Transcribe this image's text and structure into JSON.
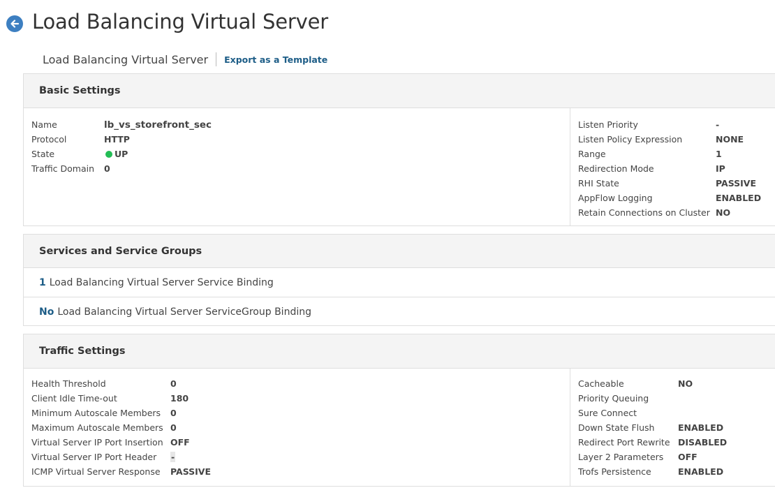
{
  "page": {
    "title": "Load Balancing Virtual Server",
    "subtitle": "Load Balancing Virtual Server",
    "export_link": "Export as a Template"
  },
  "basic_settings": {
    "header": "Basic Settings",
    "left": [
      {
        "label": "Name",
        "value": "lb_vs_storefront_sec"
      },
      {
        "label": "Protocol",
        "value": "HTTP"
      },
      {
        "label": "State",
        "value": "UP",
        "status_color": "#23bd55"
      },
      {
        "label": "Traffic Domain",
        "value": "0"
      }
    ],
    "right": [
      {
        "label": "Listen Priority",
        "value": "-"
      },
      {
        "label": "Listen Policy Expression",
        "value": "NONE"
      },
      {
        "label": "Range",
        "value": "1"
      },
      {
        "label": "Redirection Mode",
        "value": "IP"
      },
      {
        "label": "RHI State",
        "value": "PASSIVE"
      },
      {
        "label": "AppFlow Logging",
        "value": "ENABLED"
      },
      {
        "label": "Retain Connections on Cluster",
        "value": "NO"
      }
    ]
  },
  "services": {
    "header": "Services and Service Groups",
    "rows": [
      {
        "count": "1",
        "label": "Load Balancing Virtual Server Service Binding"
      },
      {
        "count": "No",
        "label": "Load Balancing Virtual Server ServiceGroup Binding"
      }
    ]
  },
  "traffic_settings": {
    "header": "Traffic Settings",
    "left": [
      {
        "label": "Health Threshold",
        "value": "0"
      },
      {
        "label": "Client Idle Time-out",
        "value": "180"
      },
      {
        "label": "Minimum Autoscale Members",
        "value": "0"
      },
      {
        "label": "Maximum Autoscale Members",
        "value": "0"
      },
      {
        "label": "Virtual Server IP Port Insertion",
        "value": "OFF"
      },
      {
        "label": "Virtual Server IP Port Header",
        "value": "-"
      },
      {
        "label": "ICMP Virtual Server Response",
        "value": "PASSIVE"
      }
    ],
    "right": [
      {
        "label": "Cacheable",
        "value": "NO"
      },
      {
        "label": "Priority Queuing",
        "value": ""
      },
      {
        "label": "Sure Connect",
        "value": ""
      },
      {
        "label": "Down State Flush",
        "value": "ENABLED"
      },
      {
        "label": "Redirect Port Rewrite",
        "value": "DISABLED"
      },
      {
        "label": "Layer 2 Parameters",
        "value": "OFF"
      },
      {
        "label": "Trofs Persistence",
        "value": "ENABLED"
      }
    ]
  },
  "colors": {
    "accent": "#1d5d87",
    "back_button": "#3d7fc1",
    "status_up": "#23bd55"
  },
  "icons": {
    "back": "arrow-left-circle-icon",
    "status": "status-dot-icon"
  }
}
